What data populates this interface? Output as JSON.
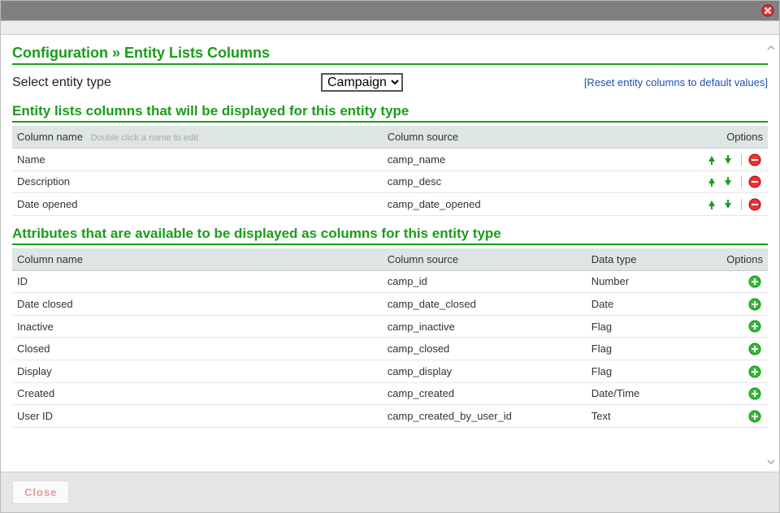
{
  "page": {
    "title": "Configuration » Entity Lists Columns",
    "select_label": "Select entity type",
    "entity_type": "Campaign",
    "reset_link": "[Reset entity columns to default values]",
    "displayed_section_title": "Entity lists columns that will be displayed for this entity type",
    "available_section_title": "Attributes that are available to be displayed as columns for this entity type",
    "close_button": "Close"
  },
  "displayed_table": {
    "headers": {
      "name": "Column name",
      "hint": "Double click a name to edit",
      "source": "Column source",
      "options": "Options"
    },
    "rows": [
      {
        "name": "Name",
        "source": "camp_name"
      },
      {
        "name": "Description",
        "source": "camp_desc"
      },
      {
        "name": "Date opened",
        "source": "camp_date_opened"
      }
    ]
  },
  "available_table": {
    "headers": {
      "name": "Column name",
      "source": "Column source",
      "type": "Data type",
      "options": "Options"
    },
    "rows": [
      {
        "name": "ID",
        "source": "camp_id",
        "type": "Number"
      },
      {
        "name": "Date closed",
        "source": "camp_date_closed",
        "type": "Date"
      },
      {
        "name": "Inactive",
        "source": "camp_inactive",
        "type": "Flag"
      },
      {
        "name": "Closed",
        "source": "camp_closed",
        "type": "Flag"
      },
      {
        "name": "Display",
        "source": "camp_display",
        "type": "Flag"
      },
      {
        "name": "Created",
        "source": "camp_created",
        "type": "Date/Time"
      },
      {
        "name": "User ID",
        "source": "camp_created_by_user_id",
        "type": "Text"
      }
    ]
  }
}
